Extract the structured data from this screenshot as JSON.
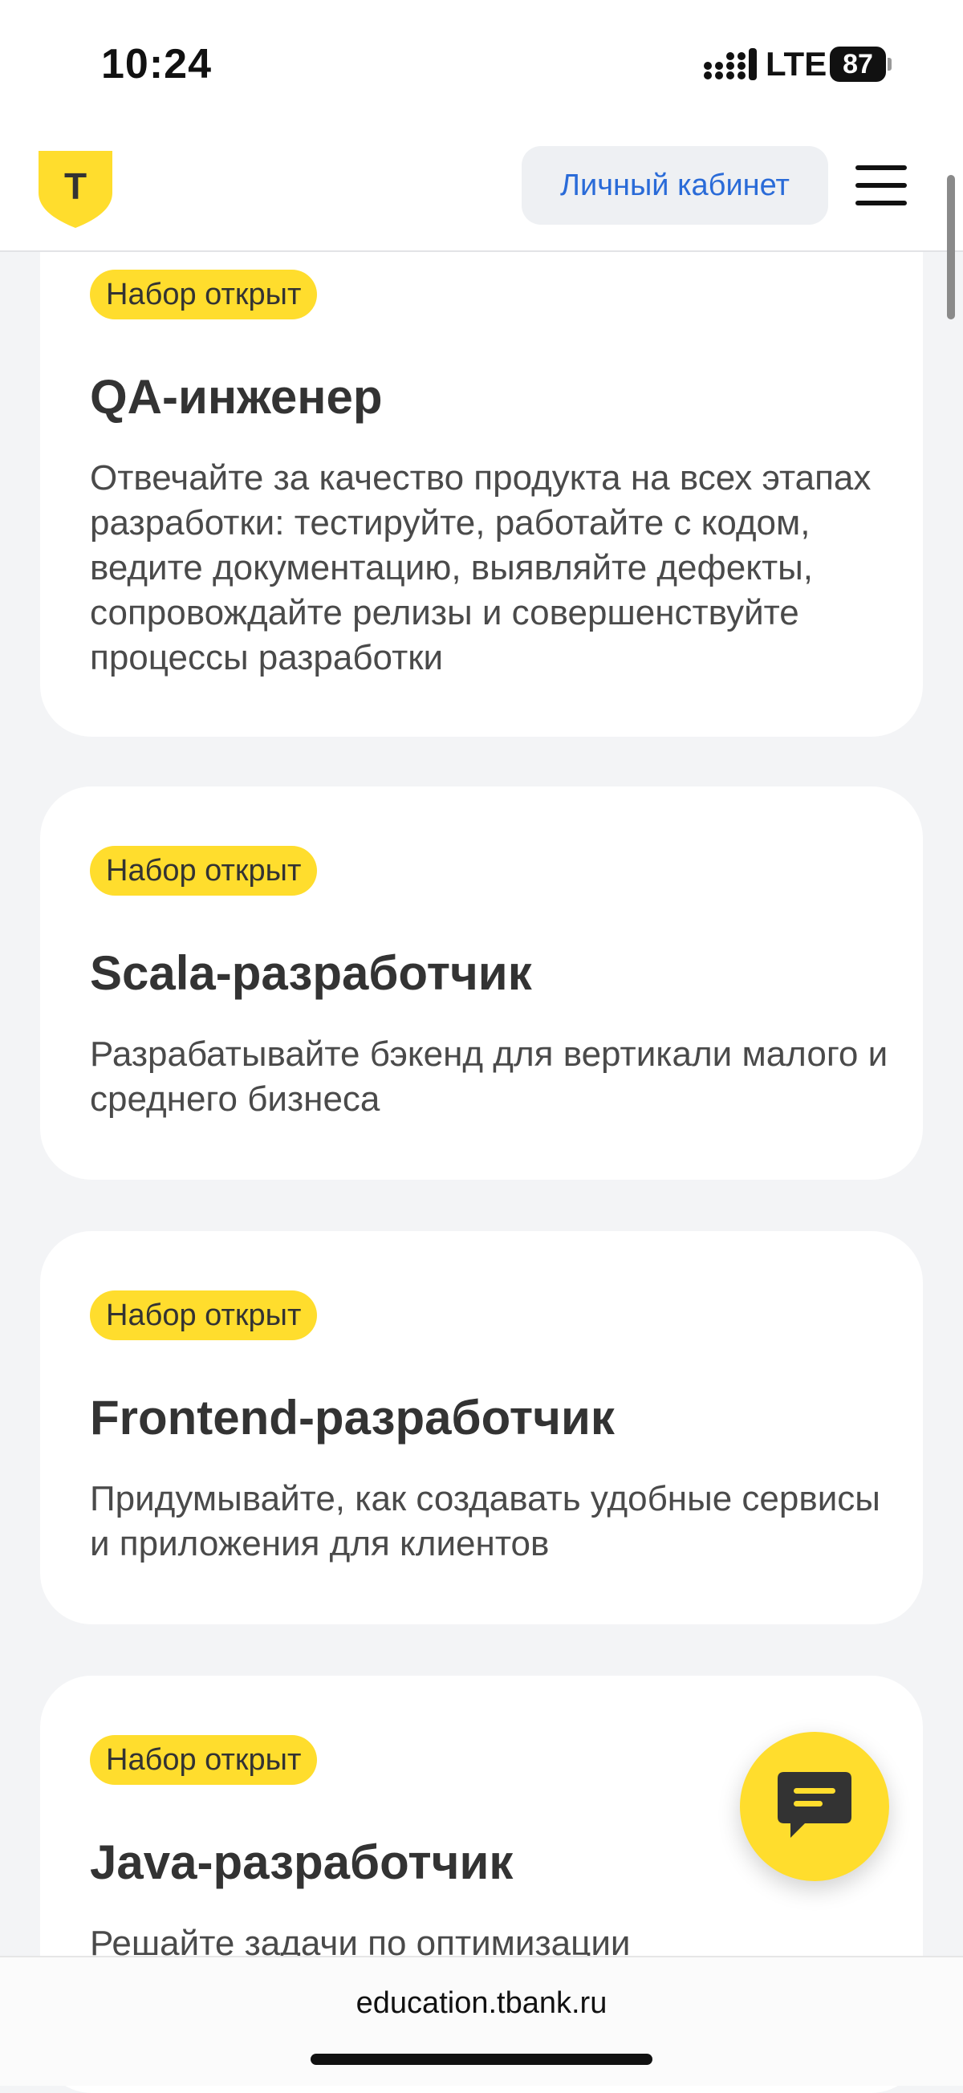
{
  "status": {
    "time": "10:24",
    "network": "LTE",
    "battery": "87"
  },
  "header": {
    "cabinet_label": "Личный кабинет",
    "logo_letter": "Т"
  },
  "cards": [
    {
      "badge": "Набор открыт",
      "title": "QA-инженер",
      "description": "Отвечайте за качество продукта на всех этапах разработки: тестируйте, работайте с кодом, ведите документацию, выявляйте дефекты, сопровождайте релизы и совершенствуйте процессы разработки"
    },
    {
      "badge": "Набор открыт",
      "title": "Scala-разработчик",
      "description": "Разрабатывайте бэкенд для вертикали малого и среднего бизнеса"
    },
    {
      "badge": "Набор открыт",
      "title": "Frontend-разработчик",
      "description": "Придумывайте, как создавать удобные сервисы и приложения для клиентов"
    },
    {
      "badge": "Набор открыт",
      "title": "Java-разработчик",
      "description": "Решайте задачи по оптимизации"
    }
  ],
  "browser": {
    "url": "education.tbank.ru"
  },
  "colors": {
    "accent_yellow": "#ffdd2d",
    "link_blue": "#2a6bd8",
    "page_bg": "#f3f4f6"
  }
}
